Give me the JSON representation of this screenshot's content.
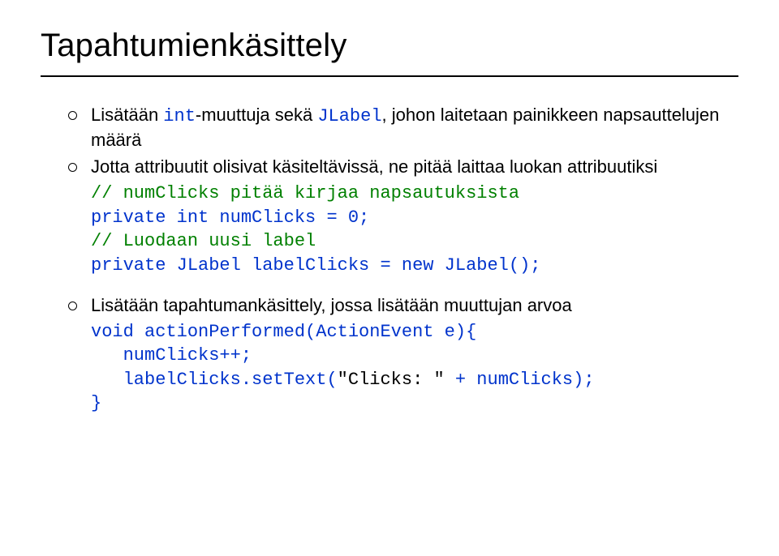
{
  "title": "Tapahtumienkäsittely",
  "bullets": [
    {
      "segments": [
        {
          "text": "Lisätään ",
          "cls": ""
        },
        {
          "text": "int",
          "cls": "blue mono"
        },
        {
          "text": "-muuttuja sekä ",
          "cls": ""
        },
        {
          "text": "JLabel",
          "cls": "blue mono"
        },
        {
          "text": ", johon laitetaan painikkeen napsauttelujen määrä",
          "cls": ""
        }
      ]
    },
    {
      "segments": [
        {
          "text": "Jotta attribuutit olisivat käsiteltävissä, ne pitää laittaa luokan attribuutiksi",
          "cls": ""
        }
      ]
    }
  ],
  "code1": [
    {
      "segments": [
        {
          "text": "// numClicks pitää kirjaa napsautuksista",
          "cls": "green"
        }
      ]
    },
    {
      "segments": [
        {
          "text": "private int numClicks = 0;",
          "cls": "blue"
        }
      ]
    },
    {
      "segments": [
        {
          "text": "// Luodaan uusi label",
          "cls": "green"
        }
      ]
    },
    {
      "segments": [
        {
          "text": "private JLabel labelClicks = new JLabel();",
          "cls": "blue"
        }
      ]
    }
  ],
  "bullet3": {
    "segments": [
      {
        "text": "Lisätään tapahtumankäsittely, jossa lisätään muuttujan arvoa",
        "cls": ""
      }
    ]
  },
  "code2": [
    {
      "segments": [
        {
          "text": "void actionPerformed(ActionEvent e){",
          "cls": "blue"
        }
      ]
    },
    {
      "segments": [
        {
          "text": "   numClicks++;",
          "cls": "blue"
        }
      ]
    },
    {
      "segments": [
        {
          "text": "   labelClicks.setText(",
          "cls": "blue"
        },
        {
          "text": "\"Clicks: \"",
          "cls": "black"
        },
        {
          "text": " + numClicks);",
          "cls": "blue"
        }
      ]
    },
    {
      "segments": [
        {
          "text": "}",
          "cls": "blue"
        }
      ]
    }
  ]
}
